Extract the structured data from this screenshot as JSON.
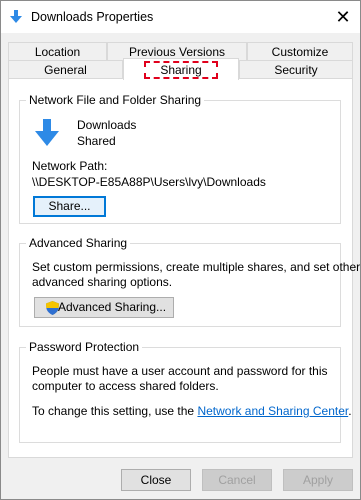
{
  "window": {
    "title": "Downloads Properties",
    "close_glyph": "✕"
  },
  "tabs": {
    "row1": [
      "Location",
      "Previous Versions",
      "Customize"
    ],
    "row2": [
      "General",
      "Sharing",
      "Security"
    ],
    "active": "Sharing"
  },
  "network_sharing": {
    "title": "Network File and Folder Sharing",
    "folder_name": "Downloads",
    "status": "Shared",
    "path_label": "Network Path:",
    "path_value": "\\\\DESKTOP-E85A88P\\Users\\lvy\\Downloads",
    "share_button": "Share..."
  },
  "advanced_sharing": {
    "title": "Advanced Sharing",
    "description_line1": "Set custom permissions, create multiple shares, and set other",
    "description_line2": "advanced sharing options.",
    "button": "Advanced Sharing..."
  },
  "password_protection": {
    "title": "Password Protection",
    "description_line1": "People must have a user account and password for this",
    "description_line2": "computer to access shared folders.",
    "change_prefix": "To change this setting, use the ",
    "link_text": "Network and Sharing Center",
    "change_suffix": "."
  },
  "footer": {
    "close": "Close",
    "cancel": "Cancel",
    "apply": "Apply"
  },
  "colors": {
    "accent": "#0078d7",
    "highlight": "#e0001c",
    "link": "#0066cc",
    "icon_blue": "#2e8ae6"
  },
  "icons": {
    "title": "download-arrow-icon",
    "folder": "download-arrow-icon",
    "shield": "uac-shield-icon"
  }
}
